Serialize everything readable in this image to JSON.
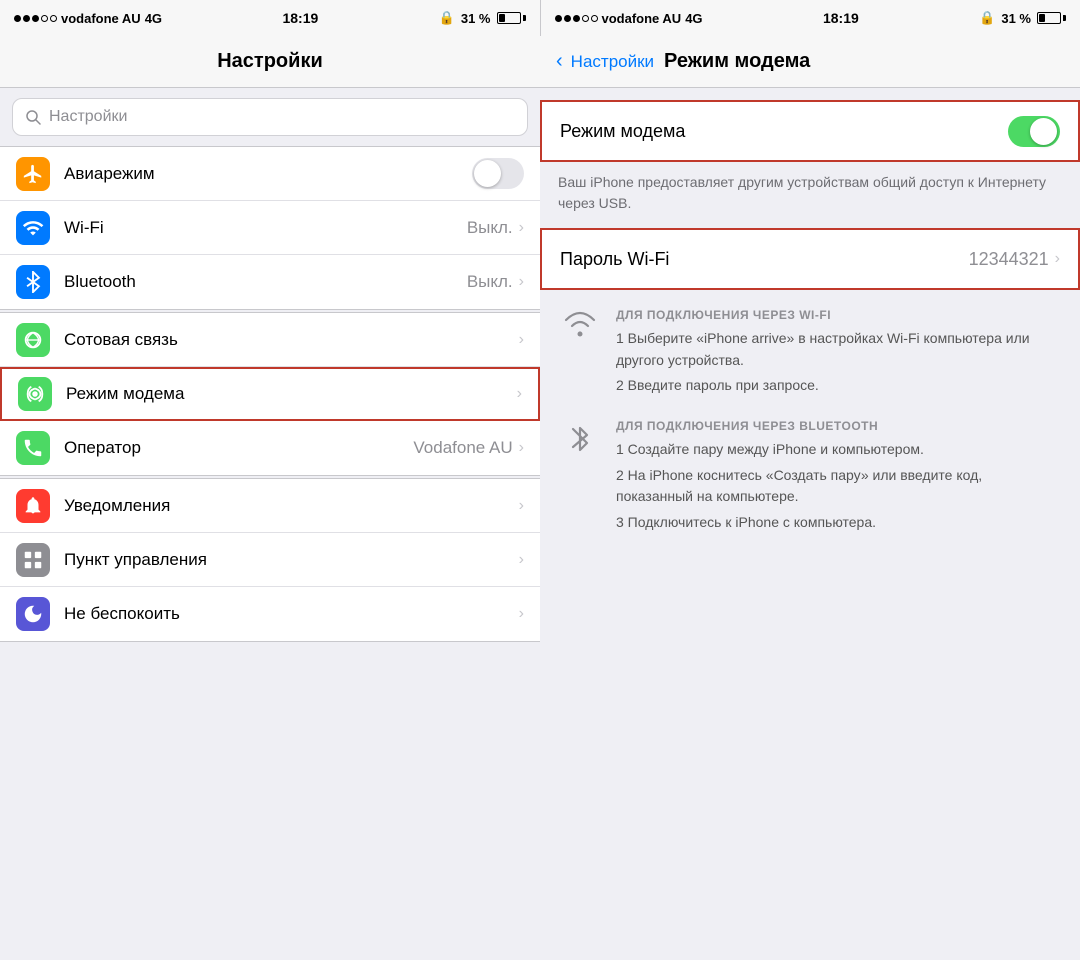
{
  "status": {
    "carrier": "vodafone AU",
    "network": "4G",
    "time": "18:19",
    "battery": "31 %"
  },
  "left": {
    "nav_title": "Настройки",
    "search_placeholder": "Настройки",
    "items": [
      {
        "id": "airplane",
        "label": "Авиарежим",
        "value": "",
        "has_toggle": true,
        "toggle_on": false,
        "has_chevron": false,
        "icon_color": "orange",
        "icon": "✈"
      },
      {
        "id": "wifi",
        "label": "Wi-Fi",
        "value": "Выкл.",
        "has_toggle": false,
        "toggle_on": false,
        "has_chevron": true,
        "icon_color": "blue",
        "icon": "wifi"
      },
      {
        "id": "bluetooth",
        "label": "Bluetooth",
        "value": "Выкл.",
        "has_toggle": false,
        "toggle_on": false,
        "has_chevron": true,
        "icon_color": "blue_dark",
        "icon": "bt"
      },
      {
        "id": "cellular",
        "label": "Сотовая связь",
        "value": "",
        "has_toggle": false,
        "toggle_on": false,
        "has_chevron": true,
        "icon_color": "green_cell",
        "icon": "cell"
      },
      {
        "id": "hotspot",
        "label": "Режим модема",
        "value": "",
        "has_toggle": false,
        "toggle_on": false,
        "has_chevron": true,
        "icon_color": "green2",
        "icon": "hotspot",
        "highlighted": true
      },
      {
        "id": "carrier",
        "label": "Оператор",
        "value": "Vodafone AU",
        "has_toggle": false,
        "toggle_on": false,
        "has_chevron": true,
        "icon_color": "green3",
        "icon": "phone"
      },
      {
        "id": "notifications",
        "label": "Уведомления",
        "value": "",
        "has_toggle": false,
        "toggle_on": false,
        "has_chevron": true,
        "icon_color": "red",
        "icon": "notif"
      },
      {
        "id": "control",
        "label": "Пункт управления",
        "value": "",
        "has_toggle": false,
        "toggle_on": false,
        "has_chevron": true,
        "icon_color": "gray",
        "icon": "control"
      },
      {
        "id": "dnd",
        "label": "Не беспокоить",
        "value": "",
        "has_toggle": false,
        "toggle_on": false,
        "has_chevron": true,
        "icon_color": "moon",
        "icon": "moon"
      }
    ]
  },
  "right": {
    "back_label": "Настройки",
    "nav_title": "Режим модема",
    "modem_toggle_label": "Режим модема",
    "modem_on": true,
    "description": "Ваш iPhone предоставляет другим устройствам общий доступ к Интернету через USB.",
    "wifi_password_label": "Пароль Wi-Fi",
    "wifi_password_value": "12344321",
    "wifi_section_heading": "ДЛЯ ПОДКЛЮЧЕНИЯ ЧЕРЕЗ WI-FI",
    "wifi_step1": "1 Выберите «iPhone arrive» в настройках Wi-Fi компьютера или другого устройства.",
    "wifi_step2": "2 Введите пароль при запросе.",
    "bt_section_heading": "ДЛЯ ПОДКЛЮЧЕНИЯ ЧЕРЕЗ BLUETOOTH",
    "bt_step1": "1 Создайте пару между iPhone и компьютером.",
    "bt_step2": "2 На iPhone коснитесь «Создать пару» или введите код, показанный на компьютере.",
    "bt_step3": "3 Подключитесь к iPhone с компьютера."
  }
}
